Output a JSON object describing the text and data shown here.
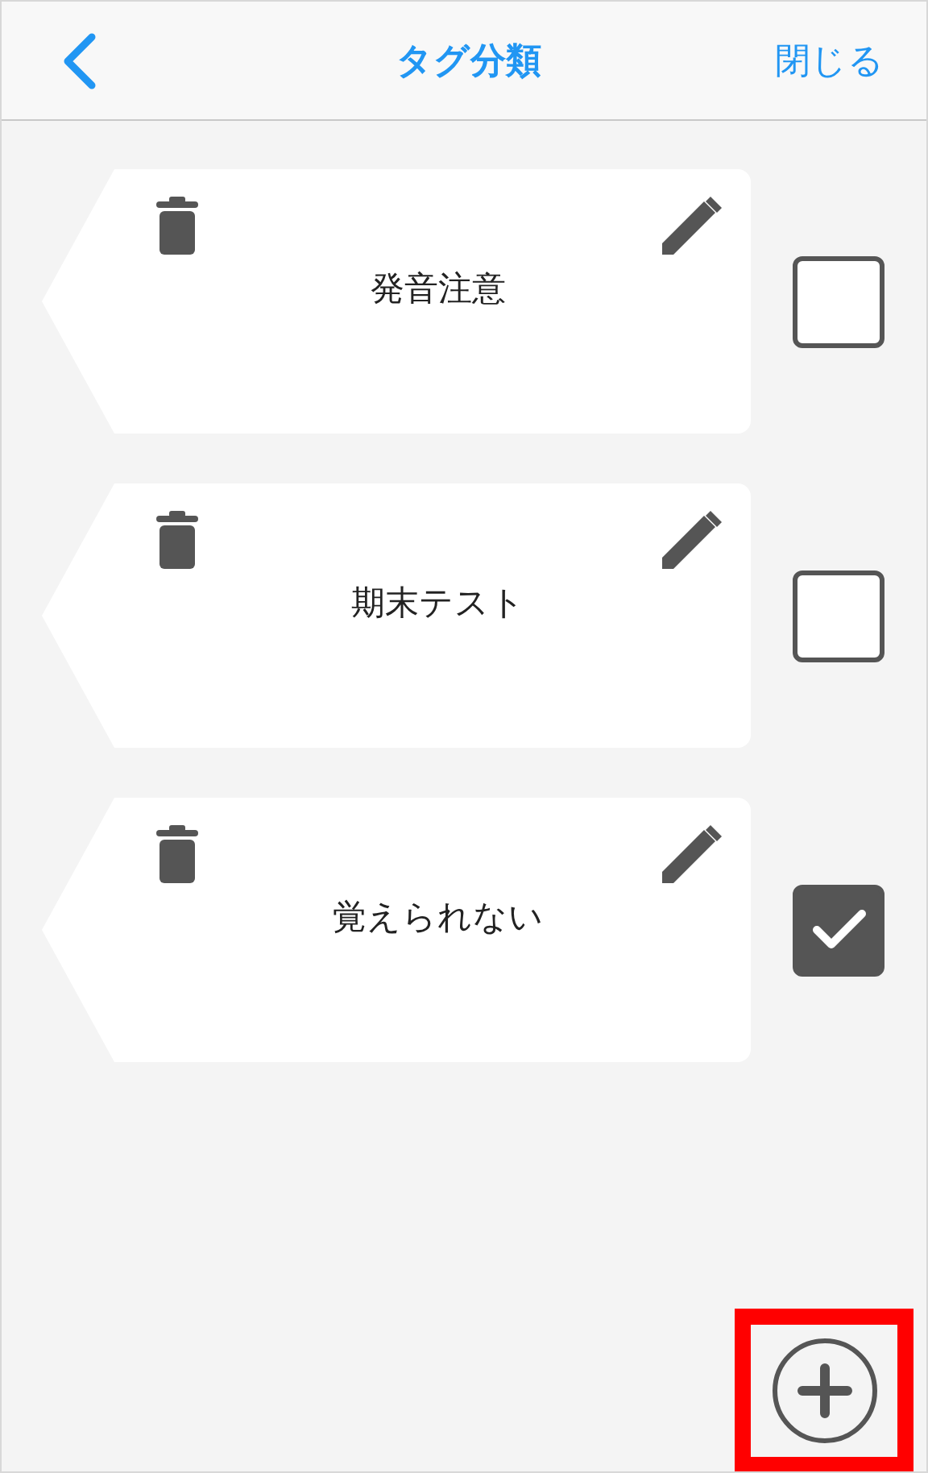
{
  "header": {
    "title": "タグ分類",
    "close_label": "閉じる"
  },
  "tags": [
    {
      "name": "発音注意",
      "checked": false
    },
    {
      "name": "期末テスト",
      "checked": false
    },
    {
      "name": "覚えられない",
      "checked": true
    }
  ]
}
